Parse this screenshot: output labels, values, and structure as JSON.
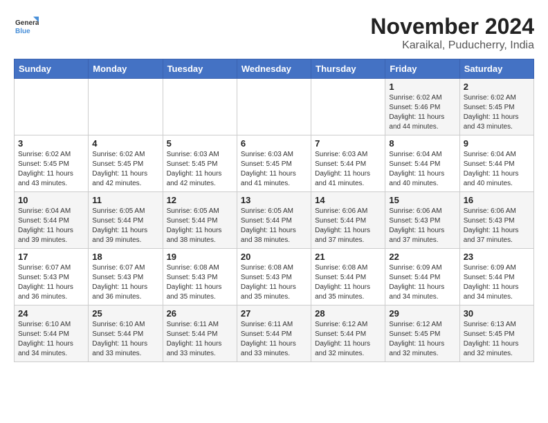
{
  "logo": {
    "name_part1": "General",
    "name_part2": "Blue"
  },
  "title": "November 2024",
  "subtitle": "Karaikal, Puducherry, India",
  "header": {
    "days": [
      "Sunday",
      "Monday",
      "Tuesday",
      "Wednesday",
      "Thursday",
      "Friday",
      "Saturday"
    ]
  },
  "weeks": [
    {
      "cells": [
        {
          "day": "",
          "info": ""
        },
        {
          "day": "",
          "info": ""
        },
        {
          "day": "",
          "info": ""
        },
        {
          "day": "",
          "info": ""
        },
        {
          "day": "",
          "info": ""
        },
        {
          "day": "1",
          "info": "Sunrise: 6:02 AM\nSunset: 5:46 PM\nDaylight: 11 hours\nand 44 minutes."
        },
        {
          "day": "2",
          "info": "Sunrise: 6:02 AM\nSunset: 5:45 PM\nDaylight: 11 hours\nand 43 minutes."
        }
      ]
    },
    {
      "cells": [
        {
          "day": "3",
          "info": "Sunrise: 6:02 AM\nSunset: 5:45 PM\nDaylight: 11 hours\nand 43 minutes."
        },
        {
          "day": "4",
          "info": "Sunrise: 6:02 AM\nSunset: 5:45 PM\nDaylight: 11 hours\nand 42 minutes."
        },
        {
          "day": "5",
          "info": "Sunrise: 6:03 AM\nSunset: 5:45 PM\nDaylight: 11 hours\nand 42 minutes."
        },
        {
          "day": "6",
          "info": "Sunrise: 6:03 AM\nSunset: 5:45 PM\nDaylight: 11 hours\nand 41 minutes."
        },
        {
          "day": "7",
          "info": "Sunrise: 6:03 AM\nSunset: 5:44 PM\nDaylight: 11 hours\nand 41 minutes."
        },
        {
          "day": "8",
          "info": "Sunrise: 6:04 AM\nSunset: 5:44 PM\nDaylight: 11 hours\nand 40 minutes."
        },
        {
          "day": "9",
          "info": "Sunrise: 6:04 AM\nSunset: 5:44 PM\nDaylight: 11 hours\nand 40 minutes."
        }
      ]
    },
    {
      "cells": [
        {
          "day": "10",
          "info": "Sunrise: 6:04 AM\nSunset: 5:44 PM\nDaylight: 11 hours\nand 39 minutes."
        },
        {
          "day": "11",
          "info": "Sunrise: 6:05 AM\nSunset: 5:44 PM\nDaylight: 11 hours\nand 39 minutes."
        },
        {
          "day": "12",
          "info": "Sunrise: 6:05 AM\nSunset: 5:44 PM\nDaylight: 11 hours\nand 38 minutes."
        },
        {
          "day": "13",
          "info": "Sunrise: 6:05 AM\nSunset: 5:44 PM\nDaylight: 11 hours\nand 38 minutes."
        },
        {
          "day": "14",
          "info": "Sunrise: 6:06 AM\nSunset: 5:44 PM\nDaylight: 11 hours\nand 37 minutes."
        },
        {
          "day": "15",
          "info": "Sunrise: 6:06 AM\nSunset: 5:43 PM\nDaylight: 11 hours\nand 37 minutes."
        },
        {
          "day": "16",
          "info": "Sunrise: 6:06 AM\nSunset: 5:43 PM\nDaylight: 11 hours\nand 37 minutes."
        }
      ]
    },
    {
      "cells": [
        {
          "day": "17",
          "info": "Sunrise: 6:07 AM\nSunset: 5:43 PM\nDaylight: 11 hours\nand 36 minutes."
        },
        {
          "day": "18",
          "info": "Sunrise: 6:07 AM\nSunset: 5:43 PM\nDaylight: 11 hours\nand 36 minutes."
        },
        {
          "day": "19",
          "info": "Sunrise: 6:08 AM\nSunset: 5:43 PM\nDaylight: 11 hours\nand 35 minutes."
        },
        {
          "day": "20",
          "info": "Sunrise: 6:08 AM\nSunset: 5:43 PM\nDaylight: 11 hours\nand 35 minutes."
        },
        {
          "day": "21",
          "info": "Sunrise: 6:08 AM\nSunset: 5:44 PM\nDaylight: 11 hours\nand 35 minutes."
        },
        {
          "day": "22",
          "info": "Sunrise: 6:09 AM\nSunset: 5:44 PM\nDaylight: 11 hours\nand 34 minutes."
        },
        {
          "day": "23",
          "info": "Sunrise: 6:09 AM\nSunset: 5:44 PM\nDaylight: 11 hours\nand 34 minutes."
        }
      ]
    },
    {
      "cells": [
        {
          "day": "24",
          "info": "Sunrise: 6:10 AM\nSunset: 5:44 PM\nDaylight: 11 hours\nand 34 minutes."
        },
        {
          "day": "25",
          "info": "Sunrise: 6:10 AM\nSunset: 5:44 PM\nDaylight: 11 hours\nand 33 minutes."
        },
        {
          "day": "26",
          "info": "Sunrise: 6:11 AM\nSunset: 5:44 PM\nDaylight: 11 hours\nand 33 minutes."
        },
        {
          "day": "27",
          "info": "Sunrise: 6:11 AM\nSunset: 5:44 PM\nDaylight: 11 hours\nand 33 minutes."
        },
        {
          "day": "28",
          "info": "Sunrise: 6:12 AM\nSunset: 5:44 PM\nDaylight: 11 hours\nand 32 minutes."
        },
        {
          "day": "29",
          "info": "Sunrise: 6:12 AM\nSunset: 5:45 PM\nDaylight: 11 hours\nand 32 minutes."
        },
        {
          "day": "30",
          "info": "Sunrise: 6:13 AM\nSunset: 5:45 PM\nDaylight: 11 hours\nand 32 minutes."
        }
      ]
    }
  ]
}
